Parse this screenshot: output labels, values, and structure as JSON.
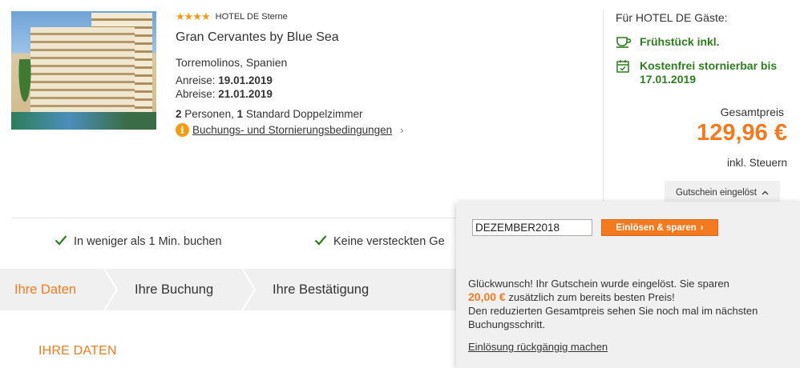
{
  "hotel": {
    "stars": "★★★★",
    "stars_label": "HOTEL DE Sterne",
    "name": "Gran Cervantes by Blue Sea",
    "location": "Torremolinos, Spanien",
    "arrival_label": "Anreise:",
    "arrival_date": "19.01.2019",
    "departure_label": "Abreise:",
    "departure_date": "21.01.2019",
    "persons_count": "2",
    "persons_text": "Personen,",
    "rooms_count": "1",
    "room_type": "Standard Doppelzimmer",
    "conditions_link": "Buchungs- und Stornierungsbedingungen"
  },
  "guest_panel": {
    "title": "Für HOTEL DE Gäste:",
    "perk_breakfast": "Frühstück inkl.",
    "perk_cancel": "Kostenfrei stornierbar bis 17.01.2019",
    "total_label": "Gesamtpreis",
    "total_price": "129,96 €",
    "tax_note": "inkl. Steuern",
    "voucher_toggle": "Gutschein eingelöst",
    "perk_color": "#2e7d1e",
    "price_color": "#f47a20"
  },
  "benefits": [
    "In weniger als 1 Min. buchen",
    "Keine versteckten Ge"
  ],
  "steps": [
    {
      "label": "Ihre Daten",
      "active": true
    },
    {
      "label": "Ihre Buchung",
      "active": false
    },
    {
      "label": "Ihre Bestätigung",
      "active": false
    }
  ],
  "section_title": "IHRE DATEN",
  "voucher_popup": {
    "code_value": "DEZEMBER2018",
    "redeem_button": "Einlösen & sparen",
    "msg_line1": "Glückwunsch! Ihr Gutschein wurde eingelöst. Sie sparen",
    "amount": "20,00 €",
    "msg_line2": "zusätzlich zum bereits besten Preis!",
    "msg_line3": "Den reduzierten Gesamtpreis sehen Sie noch mal im nächsten Buchungsschritt.",
    "undo_link": "Einlösung rückgängig machen"
  }
}
